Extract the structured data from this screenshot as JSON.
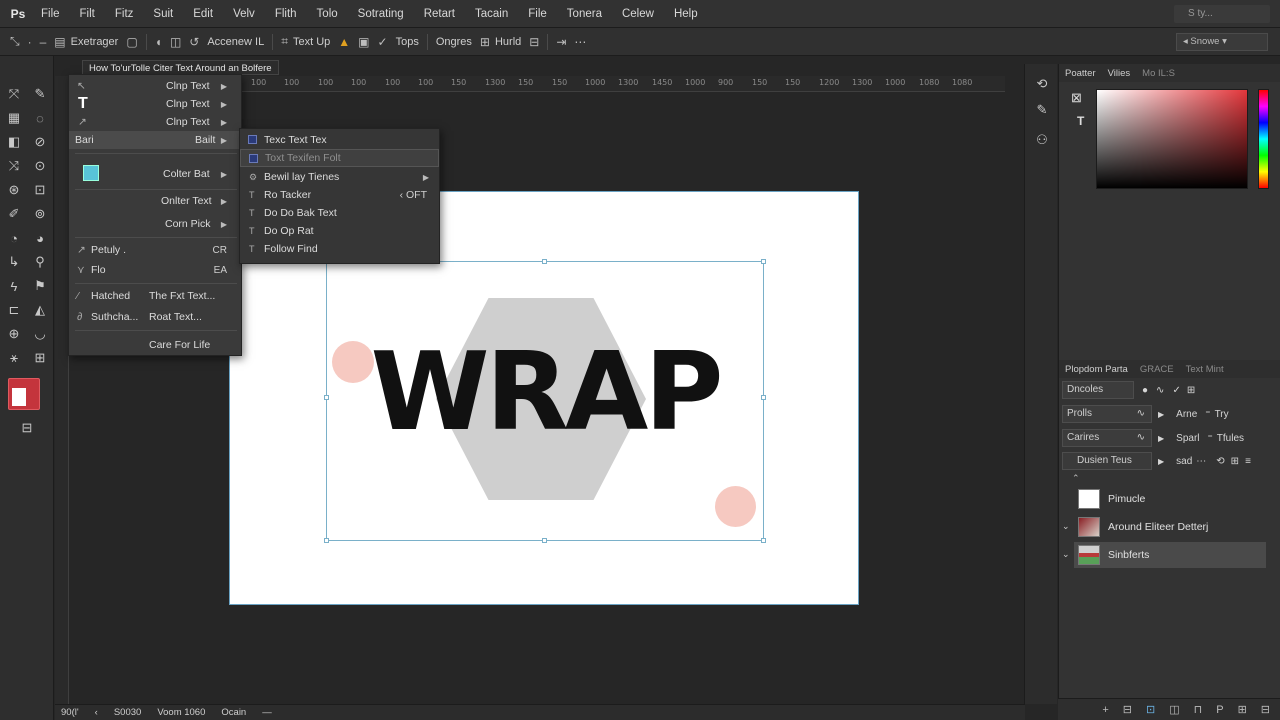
{
  "menubar": {
    "items": [
      "File",
      "Filt",
      "Fitz",
      "Suit",
      "Edit",
      "Velv",
      "Flith",
      "Tolo",
      "Sotrating",
      "Retart",
      "Tacain",
      "File",
      "Tonera",
      "Celew",
      "Help"
    ],
    "search_placeholder": "S ty..."
  },
  "optbar": {
    "items": [
      "Exetrager",
      "Accenew IL",
      "Text Up",
      "Tops",
      "Ongres",
      "Hurld"
    ],
    "select_value": "Snowe"
  },
  "document": {
    "tab_title": "How To'urTolle Citer Text Around an Bolfere",
    "canvas_text": "WRAP"
  },
  "ruler_labels": [
    "10",
    "1150",
    "100",
    "100",
    "100",
    "100",
    "100",
    "100",
    "100",
    "100",
    "100",
    "150",
    "1300",
    "150",
    "150",
    "1000",
    "1300",
    "1450",
    "1000",
    "900",
    "150",
    "150",
    "1200",
    "1300",
    "1000",
    "1080",
    "1080"
  ],
  "context_menu": {
    "items": [
      {
        "label": "Clnp Text",
        "arrow": true
      },
      {
        "label": "Clnp Text",
        "arrow": true
      },
      {
        "label": "Clnp Text",
        "arrow": true
      },
      {
        "label": "Bari",
        "right": "Bailt",
        "arrow": true
      },
      {
        "label": "Colter Bat",
        "arrow": true
      },
      {
        "label": "Onlter Text",
        "arrow": true
      },
      {
        "label": "Corn Pick",
        "arrow": true
      },
      {
        "label": "Petuly .",
        "shortcut": "CR"
      },
      {
        "label": "Flo",
        "shortcut": "EA"
      },
      {
        "label": "Hatched",
        "right": "The Fxt Text..."
      },
      {
        "label": "Suthcha...",
        "right": "Roat Text..."
      },
      {
        "label": "Care For Life"
      }
    ]
  },
  "submenu": {
    "items": [
      {
        "label": "Texc Text Tex"
      },
      {
        "label": "Toxt Texifen Folt"
      },
      {
        "label": "Bewil lay Tienes",
        "arrow": true
      },
      {
        "label": "Ro Tacker",
        "shortcut": "OFT"
      },
      {
        "label": "Do Do Bak Text"
      },
      {
        "label": "Do Op Rat"
      },
      {
        "label": "Follow Find"
      }
    ]
  },
  "color_panel": {
    "tabs": [
      "Poatter",
      "Vilies",
      "Mo IL:S"
    ]
  },
  "props_panel": {
    "tabs": [
      "Plopdom Parta",
      "GRACE",
      "Text Mint"
    ],
    "rows": [
      {
        "field": "Dncoles"
      },
      {
        "field": "Prolls",
        "a": "Arne",
        "b": "Try"
      },
      {
        "field": "Carires",
        "a": "Sparl",
        "b": "Tfules"
      },
      {
        "field": "Dusien Teus",
        "a": "sad"
      }
    ]
  },
  "layers": [
    {
      "name": "Pimucle"
    },
    {
      "name": "Around Eliteer Detterj"
    },
    {
      "name": "Sinbferts"
    }
  ],
  "status": {
    "items": [
      "90(l'",
      "S0030",
      "Voom 1060",
      "Ocain"
    ]
  },
  "colors": {
    "accent_blue": "#7ab0c9",
    "swatch_red": "#c4343c",
    "picker_hue": "#e3363b"
  }
}
